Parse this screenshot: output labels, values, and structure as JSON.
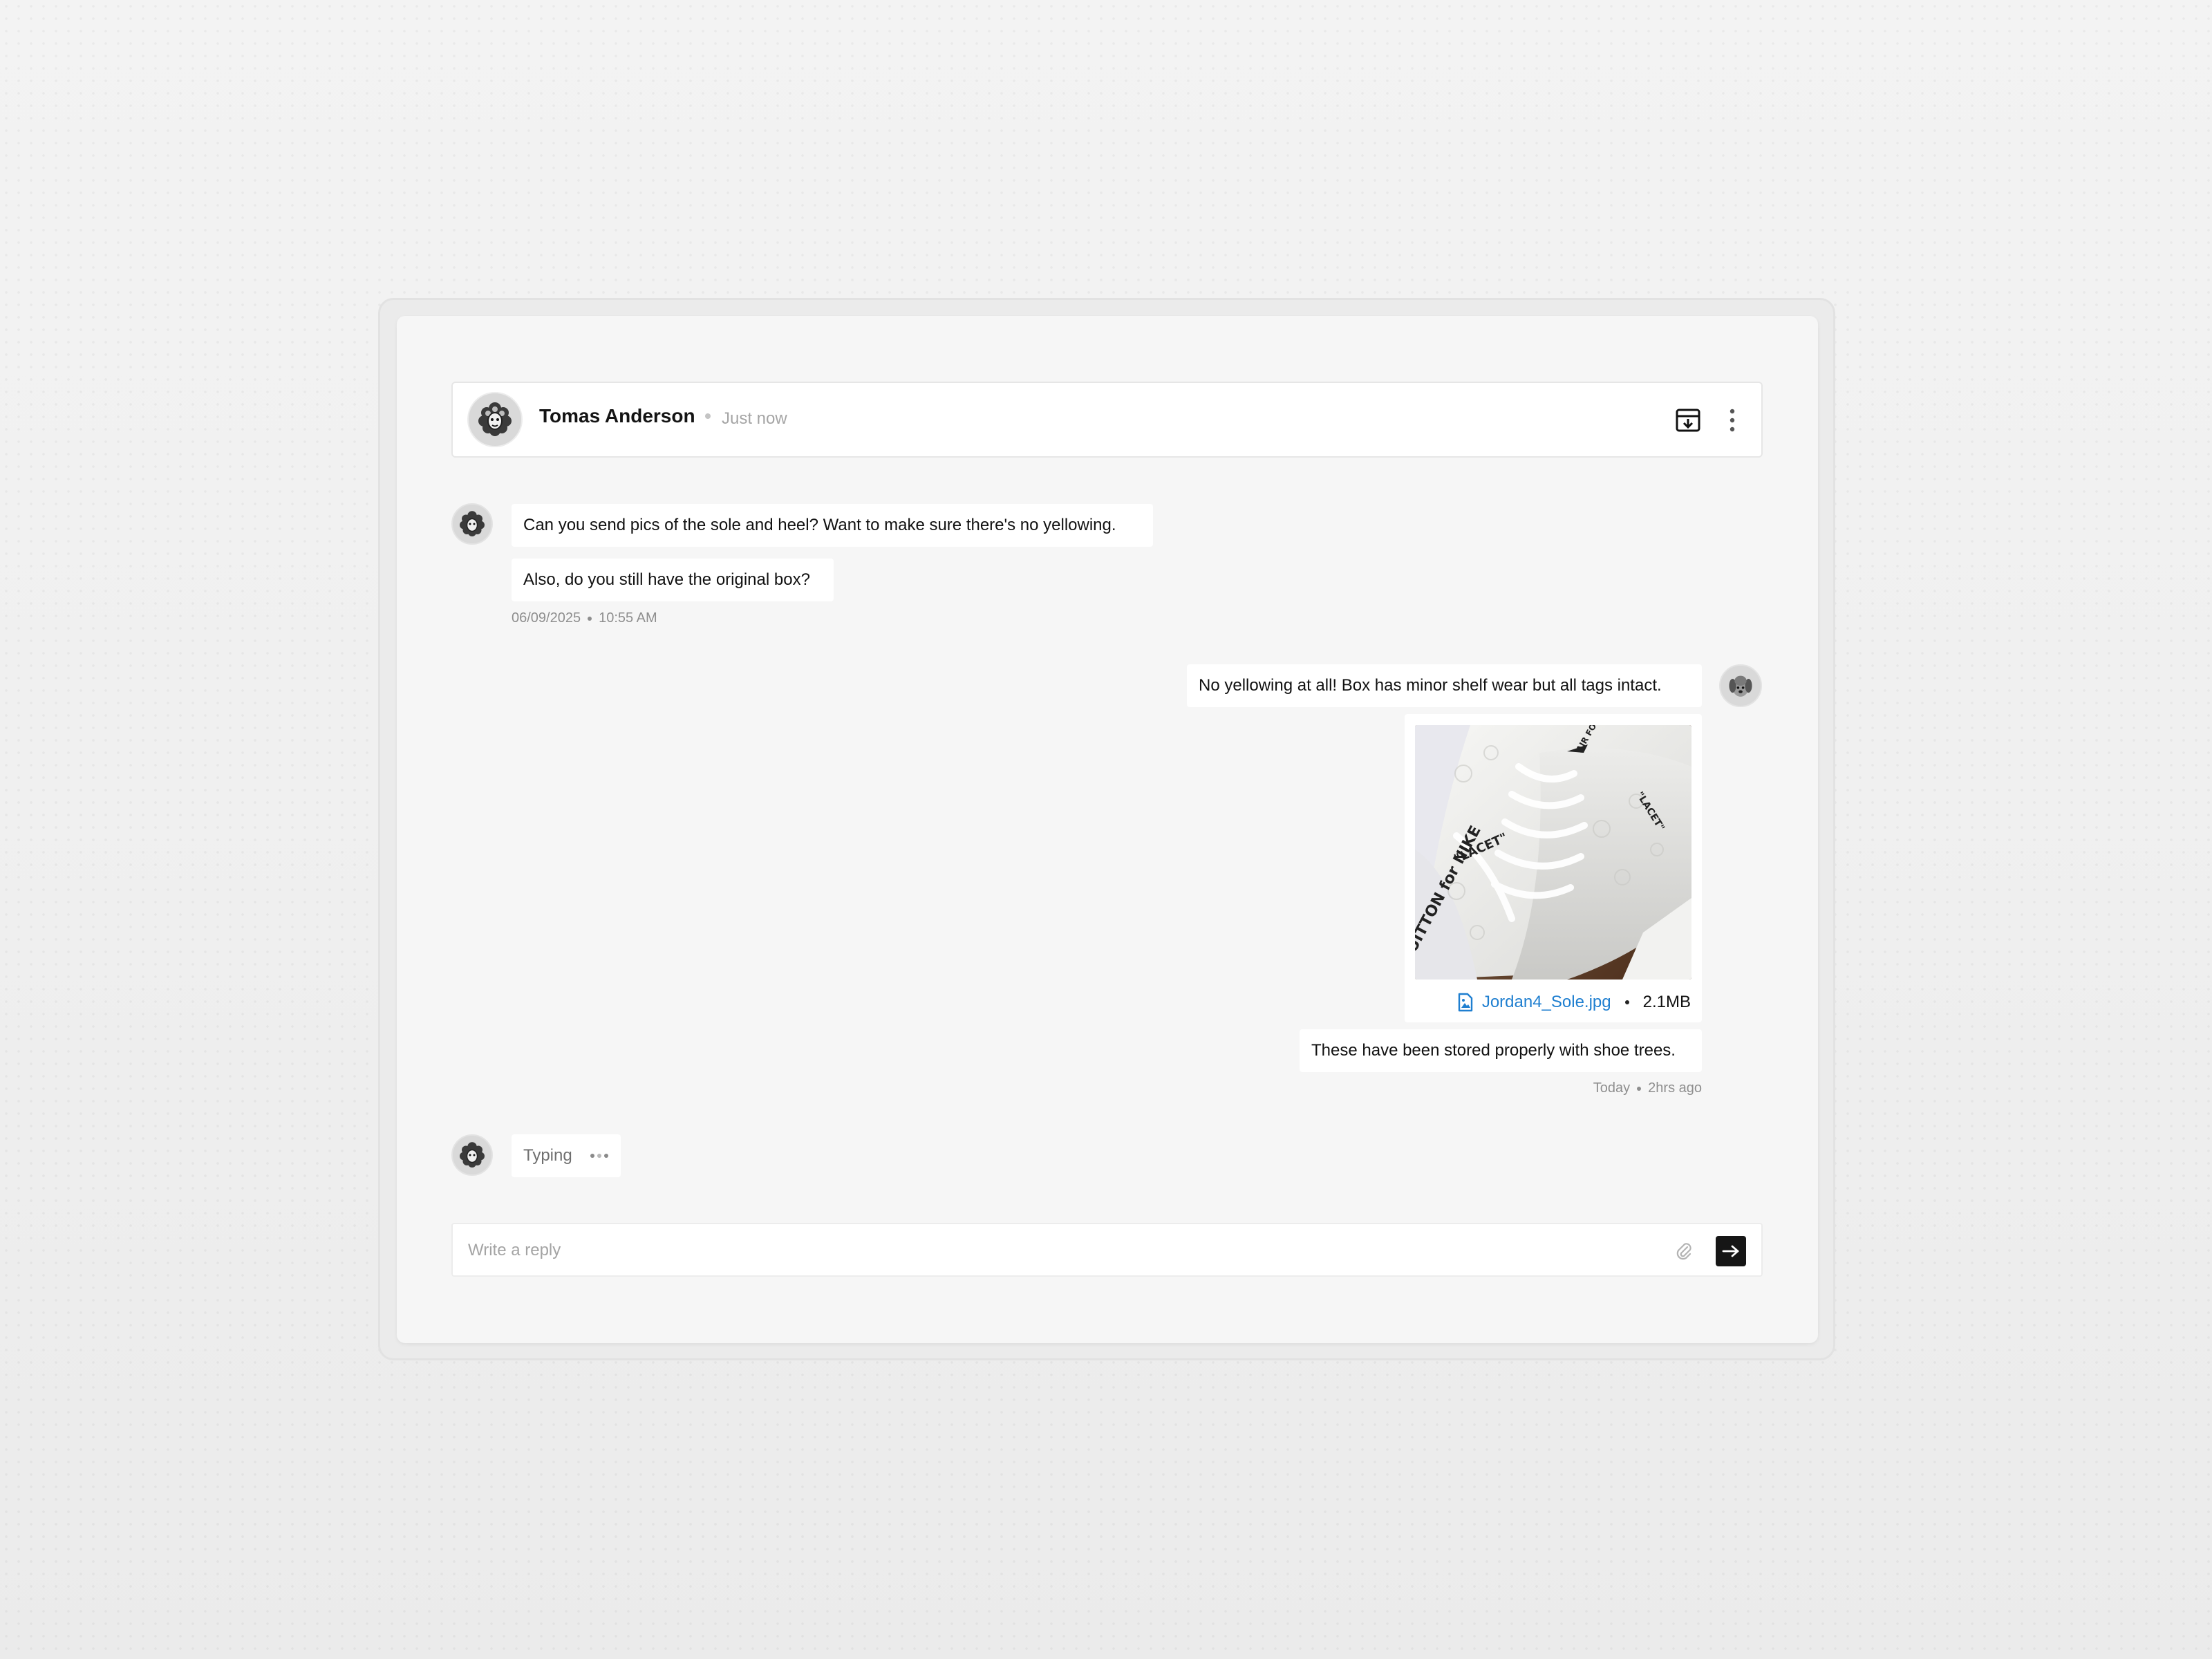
{
  "header": {
    "name": "Tomas Anderson",
    "status": "Just now",
    "archive_icon": "archive-download-icon",
    "menu_icon": "more-vertical-icon"
  },
  "messages": {
    "incoming": [
      "Can you send pics of the sole and heel? Want to make sure there's no yellowing.",
      "Also, do you still have the original box?"
    ],
    "incoming_meta": {
      "date": "06/09/2025",
      "time": "10:55 AM"
    },
    "outgoing": [
      "No yellowing at all! Box has minor shelf wear but all tags intact.",
      "These have been stored properly with shoe trees."
    ],
    "attachment": {
      "file_name": "Jordan4_Sole.jpg",
      "file_size": "2.1MB",
      "icon": "image-file-icon",
      "photo_text": [
        "\"LACET\"",
        "UITTON for NIKE",
        "AIR FO..."
      ]
    },
    "outgoing_meta": {
      "day": "Today",
      "ago": "2hrs ago"
    },
    "typing_label": "Typing"
  },
  "reply": {
    "placeholder": "Write a reply",
    "attach_icon": "paperclip-icon",
    "send_icon": "arrow-right-icon"
  },
  "colors": {
    "accent_link": "#1f7fd0",
    "send_button": "#161616"
  }
}
